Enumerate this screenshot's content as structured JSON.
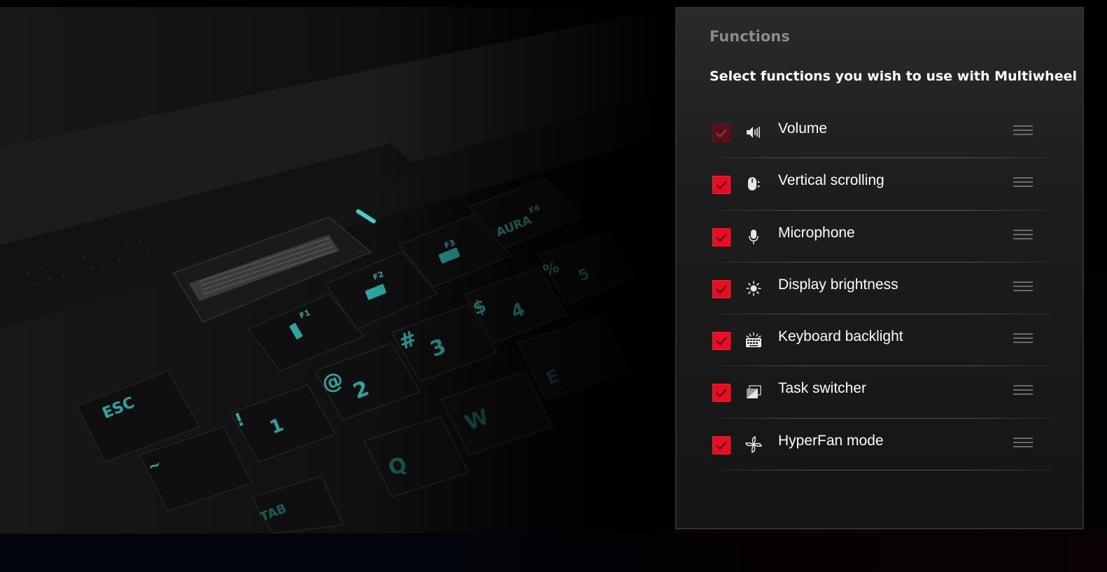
{
  "colors": {
    "accent": "#ee0a23",
    "accent_disabled": "#5a0e18",
    "keycap_glow": "#2aa5a0",
    "panel_bg": "#1d1d1d",
    "title_gray": "#8b8b8b"
  },
  "hero": {
    "key_legends": [
      "ESC",
      "F1",
      "F2",
      "F3",
      "F4",
      "AURA",
      "#",
      "3",
      "$",
      "4",
      "%",
      "5",
      "@",
      "2",
      "!",
      "1",
      "~",
      "W",
      "Q",
      "E",
      "TAB"
    ]
  },
  "panel": {
    "title": "Functions",
    "subtitle": "Select functions you wish to use with Multiwheel",
    "items": [
      {
        "label": "Volume",
        "icon": "volume-icon",
        "checked": true,
        "disabled": true
      },
      {
        "label": "Vertical scrolling",
        "icon": "mouse-scroll-icon",
        "checked": true,
        "disabled": false
      },
      {
        "label": "Microphone",
        "icon": "microphone-icon",
        "checked": true,
        "disabled": false
      },
      {
        "label": "Display brightness",
        "icon": "brightness-icon",
        "checked": true,
        "disabled": false
      },
      {
        "label": "Keyboard backlight",
        "icon": "keyboard-backlight-icon",
        "checked": true,
        "disabled": false
      },
      {
        "label": "Task switcher",
        "icon": "task-switcher-icon",
        "checked": true,
        "disabled": false
      },
      {
        "label": "HyperFan mode",
        "icon": "fan-icon",
        "checked": true,
        "disabled": false
      }
    ]
  }
}
